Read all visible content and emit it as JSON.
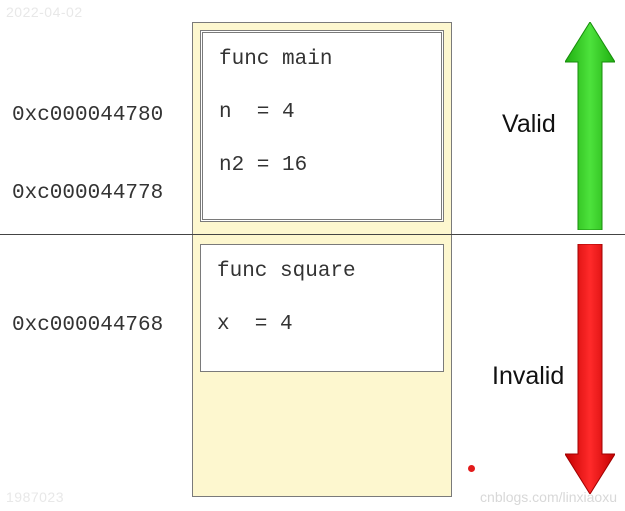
{
  "watermarks": {
    "top_left": "2022-04-02",
    "bottom_left": "1987023",
    "bottom_right": "cnblogs.com/linxiaoxu"
  },
  "addresses": {
    "addr_n": "0xc000044780",
    "addr_n2": "0xc000044778",
    "addr_x": "0xc000044768"
  },
  "frames": {
    "main": {
      "title": "func main",
      "line_n": "n  = 4",
      "line_n2": "n2 = 16"
    },
    "square": {
      "title": "func square",
      "line_x": "x  = 4"
    }
  },
  "labels": {
    "valid": "Valid",
    "invalid": "Invalid"
  },
  "colors": {
    "green": "#2fbf1e",
    "red": "#e60000",
    "stack_bg": "#fdf7cf"
  }
}
